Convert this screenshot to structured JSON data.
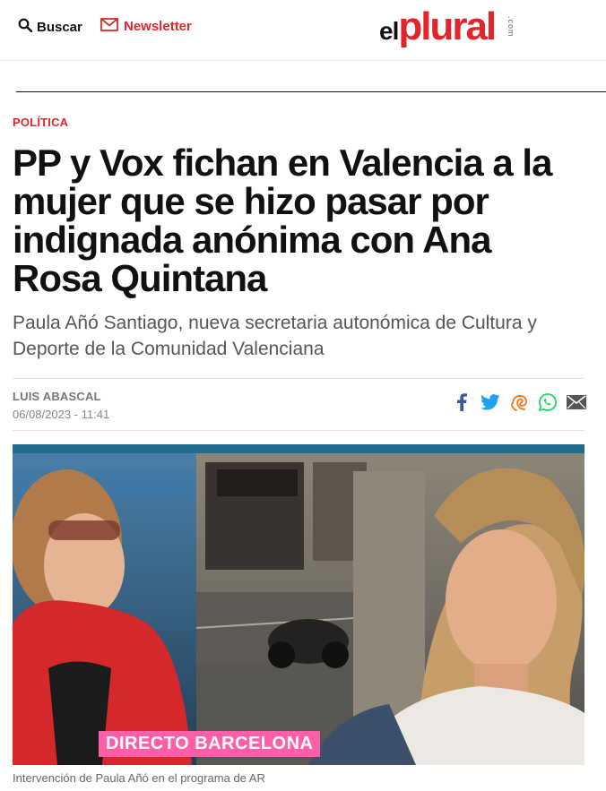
{
  "header": {
    "search_label": "Buscar",
    "newsletter_label": "Newsletter",
    "logo_el": "el",
    "logo_plural": "plural",
    "logo_com": ".com"
  },
  "article": {
    "section": "POLÍTICA",
    "headline": "PP y Vox fichan en Valencia a la mujer que se hizo pasar por indignada anónima con Ana Rosa Quintana",
    "subtitle": "Paula Añó Santiago, nueva secretaria autonómica de Cultura y Deporte de la Comunidad Valenciana",
    "author": "LUIS ABASCAL",
    "date": "06/08/2023 - 11:41",
    "image_overlay": "DIRECTO BARCELONA",
    "caption": "Intervención de Paula Añó en el programa de AR"
  },
  "share_icons": [
    "facebook-icon",
    "twitter-icon",
    "meneame-icon",
    "whatsapp-icon",
    "email-icon"
  ],
  "colors": {
    "brand_red": "#e0262b",
    "facebook": "#3b5998",
    "twitter": "#1da1f2",
    "meneame": "#f47a20",
    "whatsapp": "#25d366",
    "email": "#555555"
  }
}
